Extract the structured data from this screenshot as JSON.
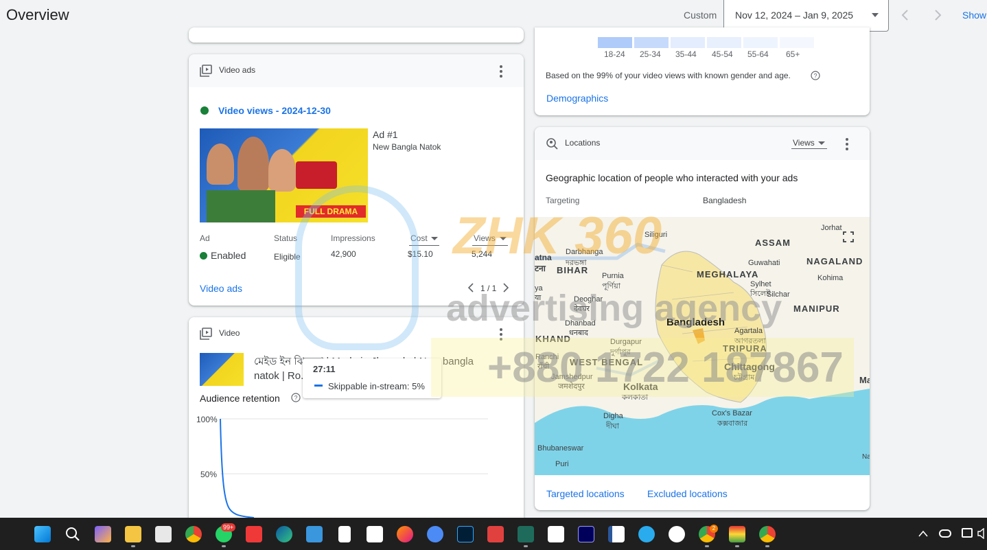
{
  "header": {
    "title": "Overview",
    "range_type": "Custom",
    "date_range": "Nov 12, 2024 – Jan 9, 2025",
    "show_label": "Show"
  },
  "video_ads_card": {
    "title": "Video ads",
    "views_label": "Video views - 2024-12-30",
    "ad_number": "Ad #1",
    "ad_name": "New Bangla Natok",
    "thumbnail_text": "FULL DRAMA",
    "columns": {
      "ad": "Ad",
      "status": "Status",
      "impressions": "Impressions",
      "cost": "Cost",
      "views": "Views"
    },
    "row": {
      "ad": "Enabled",
      "status": "Eligible",
      "impressions": "42,900",
      "cost": "$15.10",
      "views": "5,244"
    },
    "pagination": "1 / 1",
    "footer_link": "Video ads"
  },
  "video_card": {
    "title": "Video",
    "video_title_line1": "মেইড ইন ঝিনেদা | Made in Jhenada | New bangla",
    "video_title_line2": "natok | Ro... 2024",
    "retention_label": "Audience retention",
    "y_labels": [
      "100%",
      "50%"
    ],
    "tooltip_time": "27:11",
    "tooltip_series": "Skippable in-stream: 5%"
  },
  "demographics_card": {
    "age_groups": [
      "18-24",
      "25-34",
      "35-44",
      "45-54",
      "55-64",
      "65+"
    ],
    "note": "Based on the 99% of your video views with known gender and age.",
    "link": "Demographics"
  },
  "locations_card": {
    "title": "Locations",
    "metric_select": "Views",
    "heading": "Geographic location of people who interacted with your ads",
    "targeting_label": "Targeting",
    "targeting_value": "Bangladesh",
    "map_labels": [
      {
        "text": "Siliguri"
      },
      {
        "text": "Jorhat"
      },
      {
        "text": "ASSAM"
      },
      {
        "text": "NAGALAND"
      },
      {
        "text": "Darbhanga"
      },
      {
        "text": "দরভঙ্গা"
      },
      {
        "text": "BIHAR"
      },
      {
        "text": "Purnia"
      },
      {
        "text": "পূর্ণিয়া"
      },
      {
        "text": "Guwahati"
      },
      {
        "text": "MEGHALAYA"
      },
      {
        "text": "Kohima"
      },
      {
        "text": "Sylhet"
      },
      {
        "text": "সিলেট"
      },
      {
        "text": "Silchar"
      },
      {
        "text": "Deoghar"
      },
      {
        "text": "देवघर"
      },
      {
        "text": "MANIPUR"
      },
      {
        "text": "Dhanbad"
      },
      {
        "text": "धनबाद"
      },
      {
        "text": "Bangladesh"
      },
      {
        "text": "KHAND"
      },
      {
        "text": "Agartala"
      },
      {
        "text": "আগরতলা"
      },
      {
        "text": "Durgapur"
      },
      {
        "text": "দুর্গাপুর"
      },
      {
        "text": "TRIPURA"
      },
      {
        "text": "Ranchi"
      },
      {
        "text": "राँची"
      },
      {
        "text": "WEST BENGAL"
      },
      {
        "text": "Chittagong"
      },
      {
        "text": "চট্টগ্রাম"
      },
      {
        "text": "Jamshedpur"
      },
      {
        "text": "जमशेदपुर"
      },
      {
        "text": "Kolkata"
      },
      {
        "text": "কলকাতা"
      },
      {
        "text": "Cox's Bazar"
      },
      {
        "text": "কক্সবাজার"
      },
      {
        "text": "Digha"
      },
      {
        "text": "দীঘা"
      },
      {
        "text": "Bhubaneswar"
      },
      {
        "text": "Puri"
      },
      {
        "text": "atna"
      },
      {
        "text": "टना"
      },
      {
        "text": "ya"
      },
      {
        "text": "या"
      },
      {
        "text": "Ma"
      },
      {
        "text": "Na"
      }
    ],
    "link_targeted": "Targeted locations",
    "link_excluded": "Excluded locations"
  },
  "watermark": {
    "brand": "ZHK 360",
    "tagline": "advertising agency",
    "phone": "+880 1722 187867"
  },
  "taskbar": {
    "whatsapp_badge": "99+",
    "chrome_badge": "2"
  },
  "colors": {
    "accent": "#1a73e8",
    "status_green": "#188038",
    "map_water": "#7fd3e8",
    "map_land": "#f5f3ea",
    "bangladesh": "#f6e7a5",
    "taskbar": "#1f1f1f"
  }
}
